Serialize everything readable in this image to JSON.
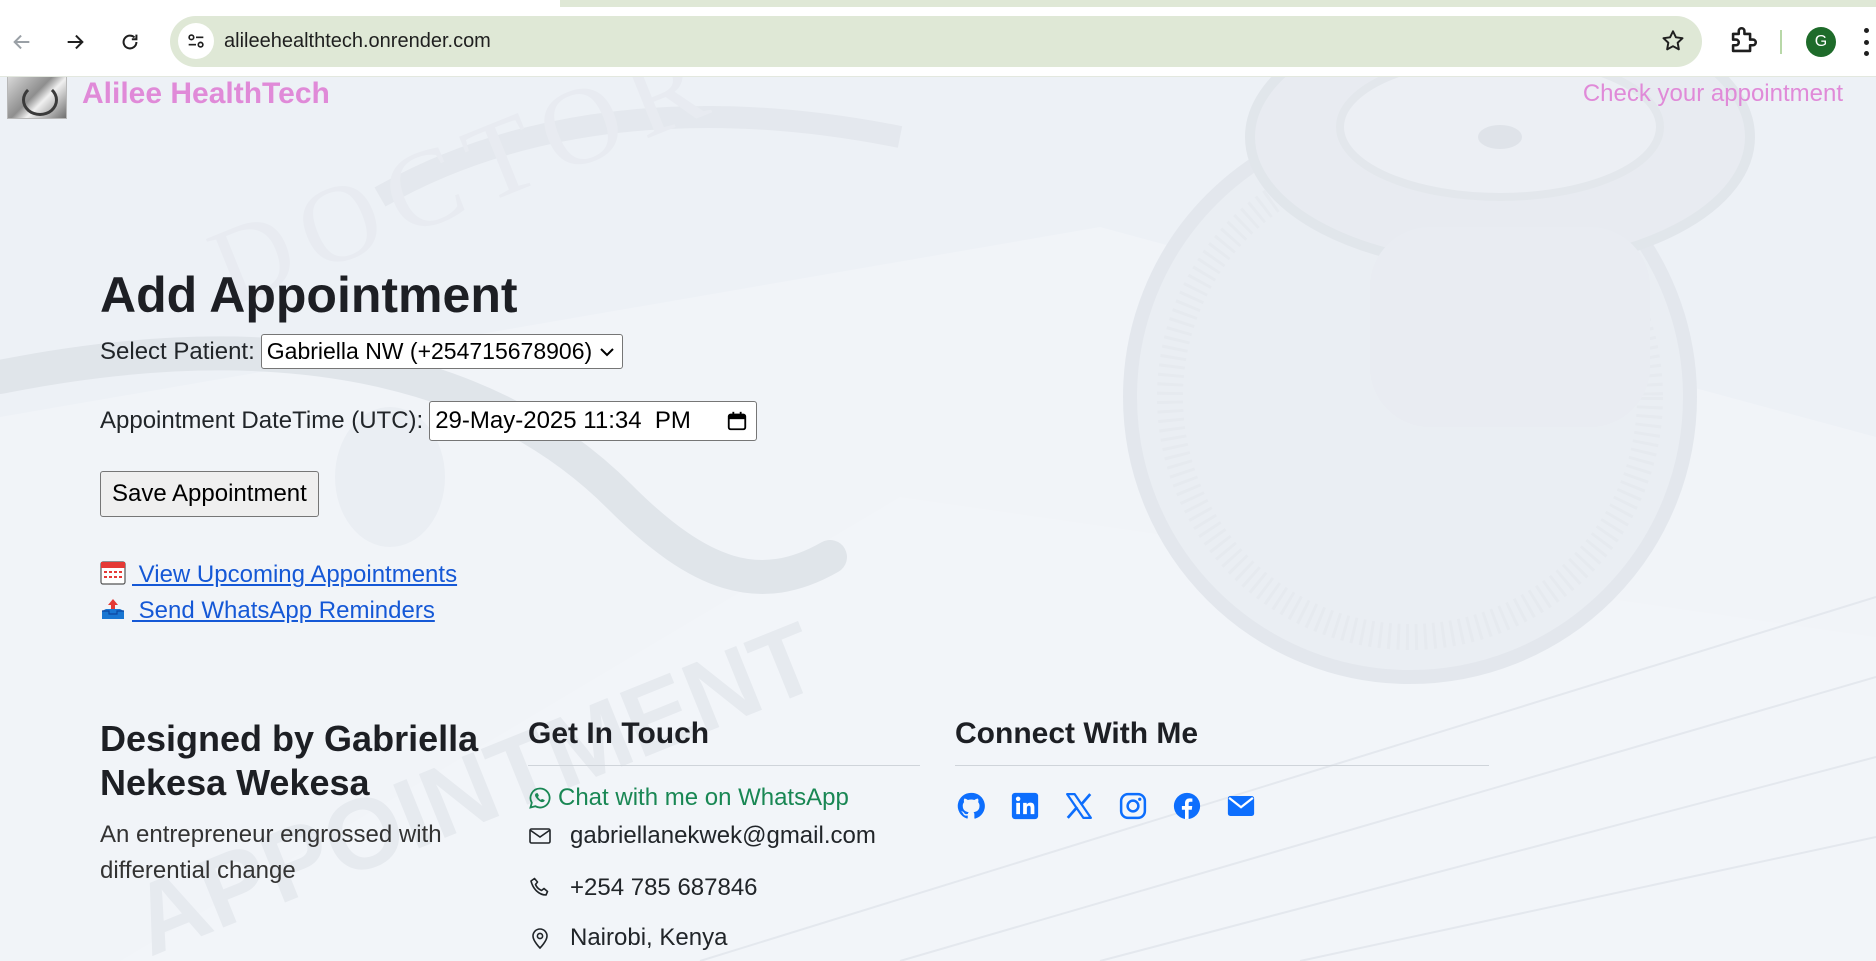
{
  "browser": {
    "url": "alileehealthtech.onrender.com",
    "profile_initial": "G"
  },
  "navbar": {
    "brand": "Alilee HealthTech",
    "link": "Check your appointment"
  },
  "form": {
    "title": "Add Appointment",
    "patient_label": "Select Patient:",
    "patient_selected": "Gabriella NW (+254715678906)",
    "datetime_label": "Appointment DateTime (UTC):",
    "datetime_value": "29-May-2025 11:34  PM",
    "save_label": "Save Appointment"
  },
  "links": {
    "upcoming": " View Upcoming Appointments",
    "reminders": " Send WhatsApp Reminders"
  },
  "footer": {
    "designer_heading": "Designed by Gabriella Nekesa Wekesa",
    "designer_sub": "An entrepreneur engrossed with differential change",
    "touch_heading": "Get In Touch",
    "whatsapp": "Chat with me on WhatsApp",
    "email": "gabriellanekwek@gmail.com",
    "phone": "+254 785 687846",
    "location": "Nairobi, Kenya",
    "connect_heading": "Connect With Me",
    "social": [
      "github-icon",
      "linkedin-icon",
      "x-icon",
      "instagram-icon",
      "facebook-icon",
      "mail-icon"
    ]
  },
  "colors": {
    "brand": "#e08ad8",
    "link": "#1558d6",
    "whatsapp": "#198754",
    "social": "#0d6efd",
    "omnibox": "#dfe8d6"
  }
}
